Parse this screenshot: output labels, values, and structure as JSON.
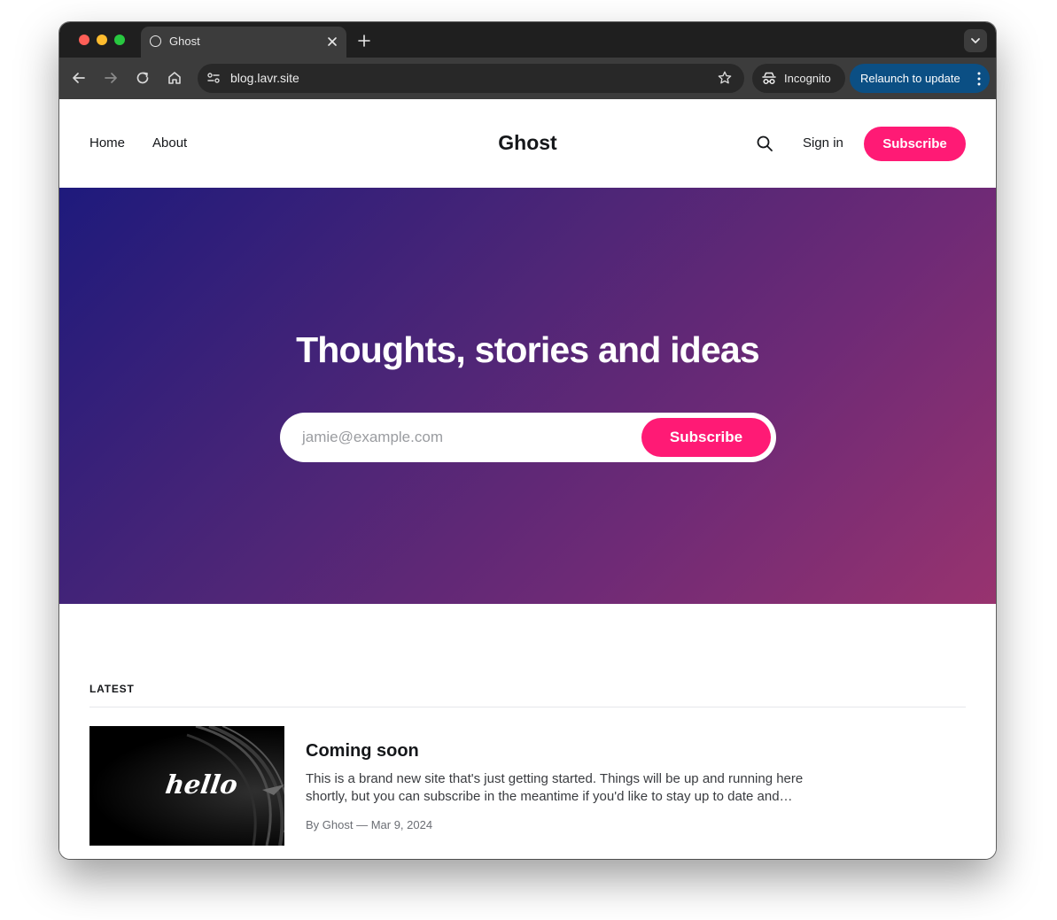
{
  "browser": {
    "tab_title": "Ghost",
    "url": "blog.lavr.site",
    "incognito_label": "Incognito",
    "relaunch_label": "Relaunch to update"
  },
  "header": {
    "nav": [
      {
        "label": "Home"
      },
      {
        "label": "About"
      }
    ],
    "brand": "Ghost",
    "sign_in": "Sign in",
    "subscribe": "Subscribe"
  },
  "hero": {
    "title": "Thoughts, stories and ideas",
    "email_placeholder": "jamie@example.com",
    "subscribe": "Subscribe",
    "colors": {
      "start": "#1e1a7c",
      "end": "#98336f"
    }
  },
  "latest": {
    "label": "LATEST",
    "posts": [
      {
        "title": "Coming soon",
        "excerpt": "This is a brand new site that's just getting started. Things will be up and running here shortly, but you can subscribe in the meantime if you'd like to stay up to date and…",
        "meta": "By Ghost — Mar 9, 2024",
        "thumbnail_text": "hello"
      }
    ]
  },
  "accent_color": "#ff1a75"
}
